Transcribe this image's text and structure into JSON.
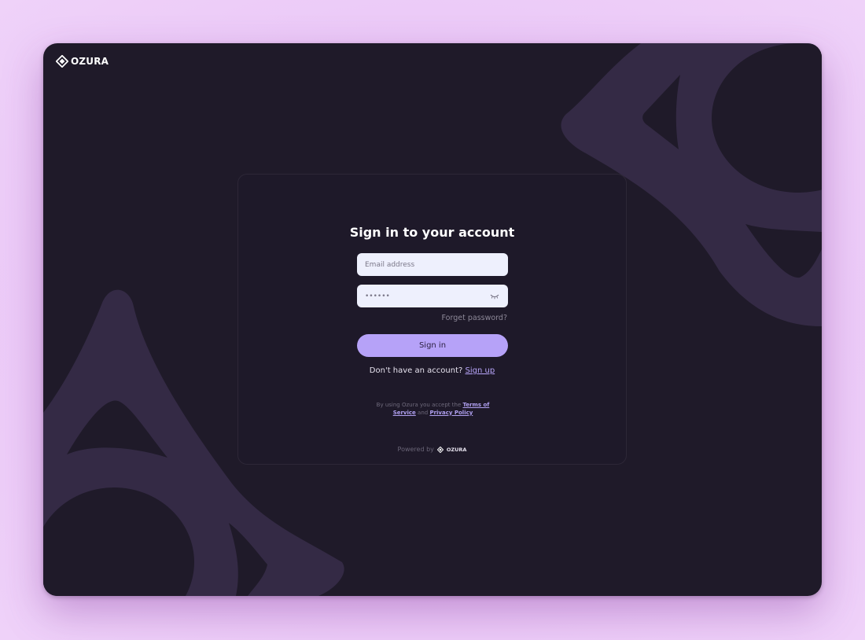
{
  "brand": {
    "name": "OZURA",
    "logo_icon": "ozura-diamond-icon"
  },
  "login": {
    "title": "Sign in to your account",
    "email_placeholder": "Email address",
    "password_value": "••••••",
    "password_toggle_icon": "eye-closed-icon",
    "forgot_password": "Forget password?",
    "signin_label": "Sign in",
    "no_account_text": "Don't have an account?",
    "signup_label": "Sign up"
  },
  "legal": {
    "prefix": "By using Ozura you accept the",
    "terms_label": "Terms of Service",
    "and": "and",
    "privacy_label": "Privacy Policy"
  },
  "footer": {
    "powered_by": "Powered by",
    "brand_name": "OZURA"
  },
  "colors": {
    "page_background": "#ebc8f7",
    "window_background": "#1f1a29",
    "decor_shape": "#342a45",
    "accent": "#b6a2f8",
    "link": "#b9a6fb",
    "input_background": "#eef0fd"
  }
}
